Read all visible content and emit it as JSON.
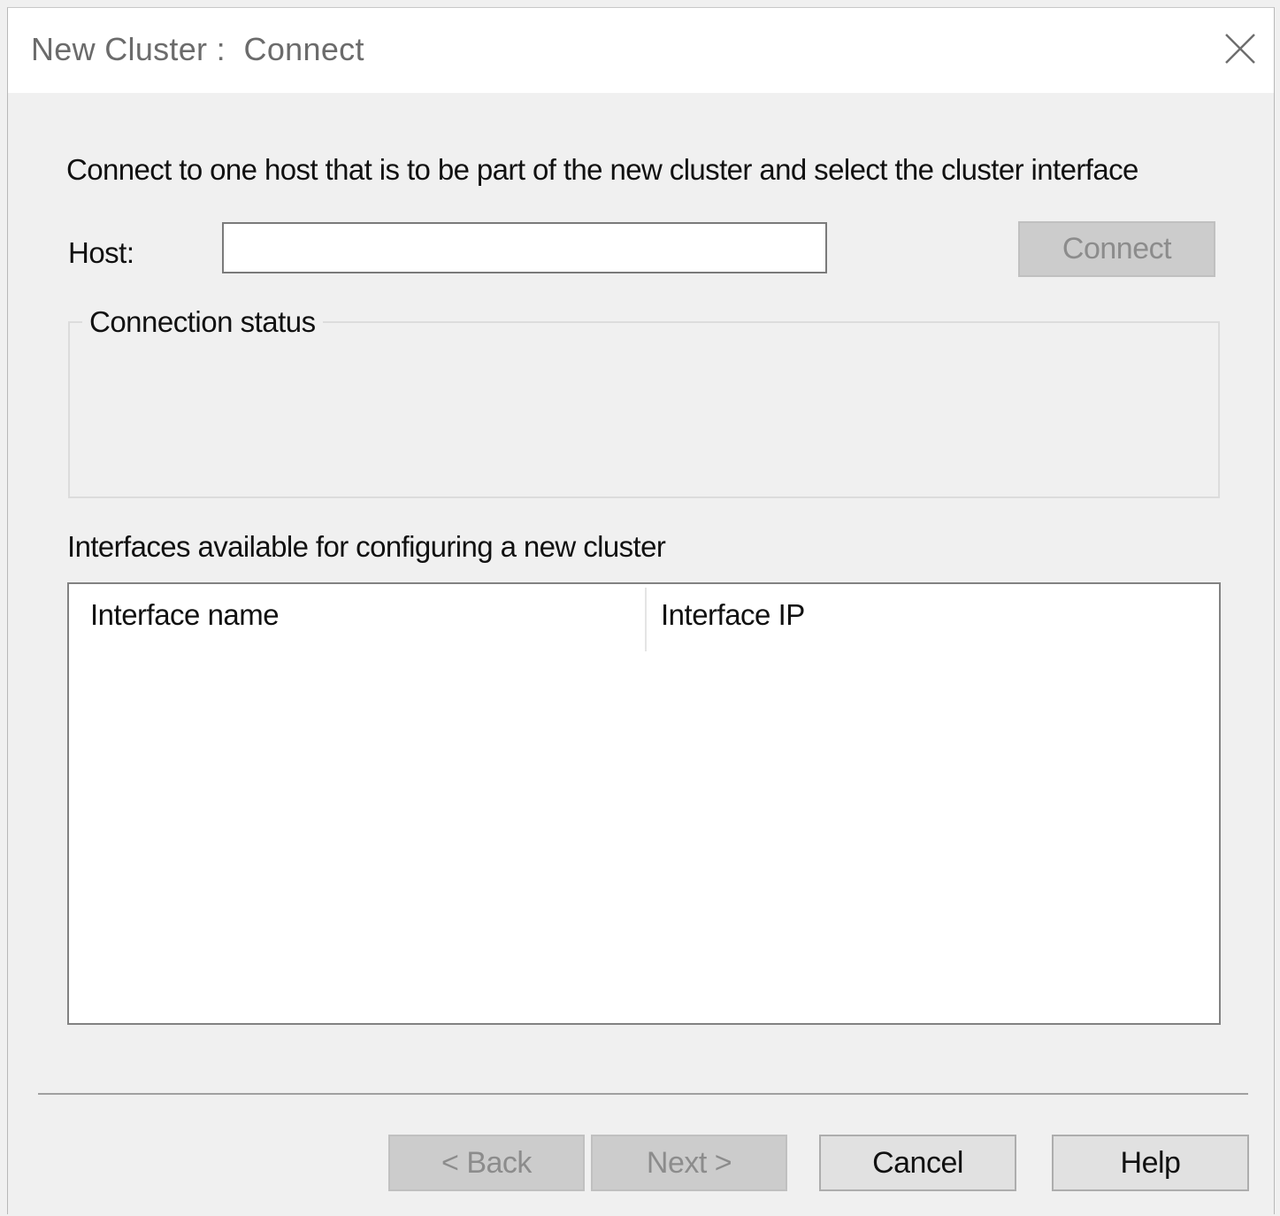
{
  "window": {
    "title": "New Cluster :  Connect",
    "close_icon": "close-icon"
  },
  "intro_text": "Connect to one host that is to be part of the new cluster and select the cluster interface",
  "host": {
    "label": "Host:",
    "value": "",
    "placeholder": ""
  },
  "connect_button": "Connect",
  "connection_status": {
    "legend": "Connection status"
  },
  "interfaces": {
    "caption": "Interfaces available for configuring a new cluster",
    "columns": [
      "Interface name",
      "Interface IP"
    ],
    "rows": []
  },
  "footer": {
    "back_label": "< Back",
    "next_label": "Next >",
    "cancel_label": "Cancel",
    "help_label": "Help"
  }
}
